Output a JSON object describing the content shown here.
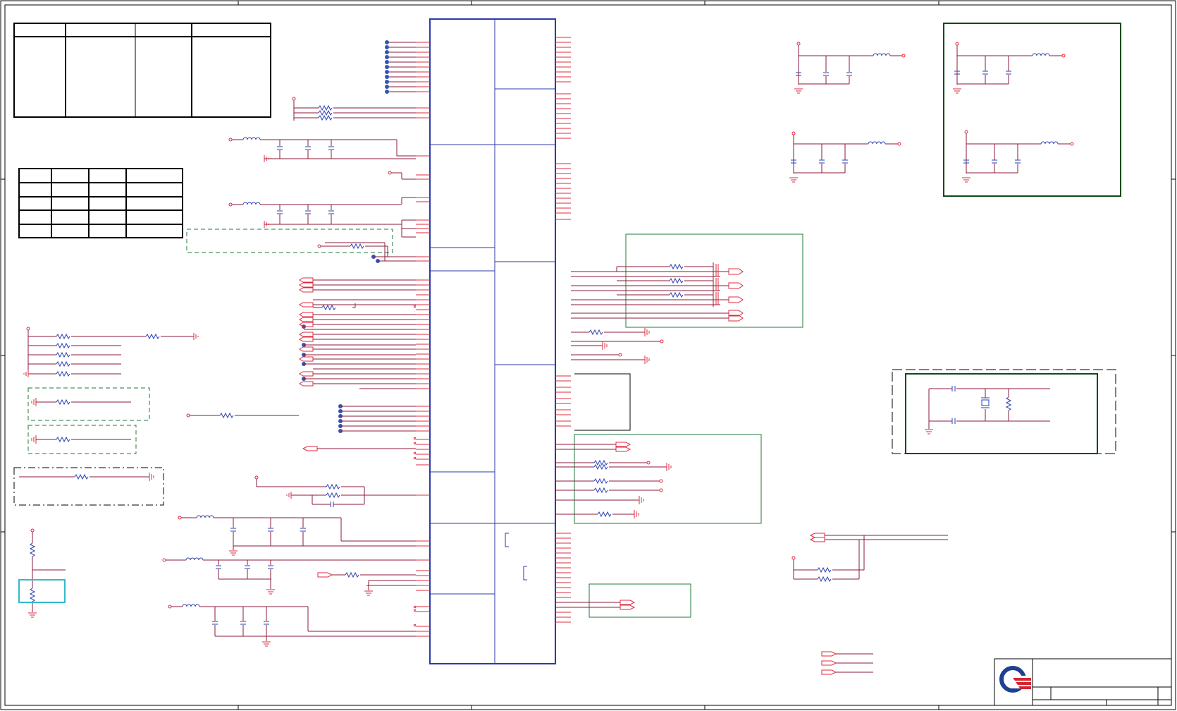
{
  "sheet": {
    "kind": "electronic schematic sheet",
    "colors": {
      "frame": "#000000",
      "wire": "#8b1a3a",
      "pin": "#e0283c",
      "component": "#2a3fb0",
      "chip_outline": "#2b3aa8",
      "highlight_green": "#1f7a3a",
      "dark_green_box": "#0e4a1a",
      "cyan_box": "#34b8cc",
      "net_junction": "#3555b5",
      "logo_blue": "#1f3f8f",
      "logo_red": "#d22630"
    },
    "icons": {
      "ground": "ground-symbol-icon",
      "resistor": "resistor-icon",
      "capacitor": "capacitor-icon",
      "inductor": "inductor-icon",
      "crystal": "crystal-icon",
      "offpage": "offpage-connector-icon",
      "logo": "company-logo-icon"
    }
  }
}
